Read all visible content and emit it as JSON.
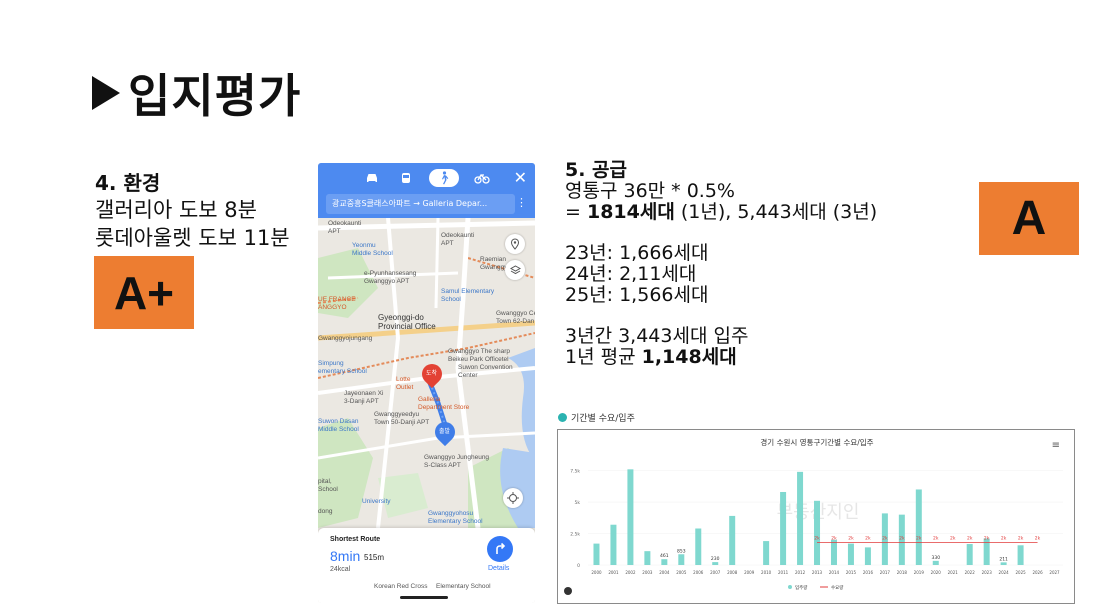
{
  "title": "입지평가",
  "environment": {
    "heading": "4. 환경",
    "line1": "갤러리아 도보 8분",
    "line2": "롯데아울렛 도보 11분",
    "grade": "A+"
  },
  "supply": {
    "heading": "5. 공급",
    "line1": "영통구 36만 * 0.5%",
    "line2_prefix": "= ",
    "line2_bold": "1814세대",
    "line2_rest": " (1년), 5,443세대 (3년)",
    "y23": "23년: 1,666세대",
    "y24": "24년: 2,11세대",
    "y25": "25년: 1,566세대",
    "total": "3년간 3,443세대 입주",
    "avg_prefix": "1년 평균 ",
    "avg_bold": "1,148세대",
    "grade": "A"
  },
  "map": {
    "route_text": "광교중흥S클래스아파트 → Galleria Depar...",
    "destination_pin": "도착",
    "origin_pin": "출발",
    "labels": {
      "odeokaunti": "Odeokaunti\nAPT",
      "yeonmu": "Yeonmu\nMiddle School",
      "raemian": "Raemian\nGwanggyo",
      "pyunhansesang": "e-Pyunhansesang\nGwanggyo APT",
      "samul": "Samul Elementary\nSchool",
      "gwanggyo_central": "Gwanggyo Ce\nTown 62-Dan",
      "gyeonggi": "Gyeonggi-do\nProvincial Office",
      "france": "UE FRANCE\nANGGYO",
      "gwanggyojungang": "Gwanggyojungang",
      "simpung": "Simpung\nementary School",
      "sharp": "Gwanggyo The sharp\nBeikeu Park Officetel",
      "convention": "Suwon Convention\nCenter",
      "lotte": "Lotte\nOutlet",
      "galleria": "Galleria\nDepartment Store",
      "jayeonaen": "Jayeonaen Xi\n3-Danji APT",
      "edyu": "Gwanggyeedyu\nTown 50-Danji APT",
      "dasan": "Suwon Dasan\nMiddle School",
      "jungheung": "Gwanggyo Jungheung\nS-Class APT",
      "university": "University",
      "hosu": "Gwanggyohosu\nElementary School",
      "dong": "dong",
      "pital": "pital,\nSchool",
      "korean": "Korean\nRed Cross",
      "elementary": "Elementary School"
    },
    "panel": {
      "label": "Shortest Route",
      "minutes": "8min",
      "distance": "515m",
      "kcal": "24kcal",
      "details": "Details"
    },
    "icons": [
      "car-icon",
      "bus-icon",
      "walk-icon",
      "bike-icon",
      "close-icon",
      "more-icon",
      "pin-icon",
      "layers-icon",
      "locate-icon",
      "turn-right-icon"
    ]
  },
  "chart_header": "기간별 수요/입주",
  "chart_data": {
    "type": "bar",
    "title": "경기 수원시 영통구기간별 수요/입주",
    "categories": [
      "2000",
      "2001",
      "2002",
      "2003",
      "2004",
      "2005",
      "2006",
      "2007",
      "2008",
      "2009",
      "2010",
      "2011",
      "2012",
      "2013",
      "2014",
      "2015",
      "2016",
      "2017",
      "2018",
      "2019",
      "2020",
      "2021",
      "2022",
      "2023",
      "2024",
      "2025",
      "2026",
      "2027"
    ],
    "series": [
      {
        "name": "입주량",
        "type": "bar",
        "color": "#7fd8cf",
        "values": [
          1700,
          3200,
          7600,
          1100,
          461,
          853,
          2900,
          230,
          3900,
          0,
          1900,
          5800,
          7400,
          5100,
          2000,
          1700,
          1400,
          4100,
          4000,
          6000,
          330,
          0,
          1666,
          2110,
          211,
          1566,
          0,
          0
        ],
        "labels": [
          "",
          "",
          "",
          "",
          "461",
          "853",
          "",
          "230",
          "",
          "",
          "",
          "",
          "",
          "",
          "",
          "",
          "",
          "",
          "",
          "",
          "330",
          "",
          "",
          "",
          "211",
          "",
          "",
          ""
        ]
      },
      {
        "name": "수요량",
        "type": "line",
        "color": "#e23b3b",
        "values": [
          null,
          null,
          null,
          null,
          null,
          null,
          null,
          null,
          null,
          null,
          null,
          null,
          null,
          1800,
          1800,
          1800,
          1800,
          1800,
          1800,
          1800,
          1800,
          1800,
          1800,
          1800,
          1800,
          1800,
          1800,
          null
        ],
        "point_labels": "2k"
      }
    ],
    "y_ticks": [
      "0",
      "2.5k",
      "5k",
      "7.5k"
    ],
    "ylim": [
      0,
      8500
    ],
    "legend_position": "bottom",
    "watermark": "부동산지인"
  }
}
